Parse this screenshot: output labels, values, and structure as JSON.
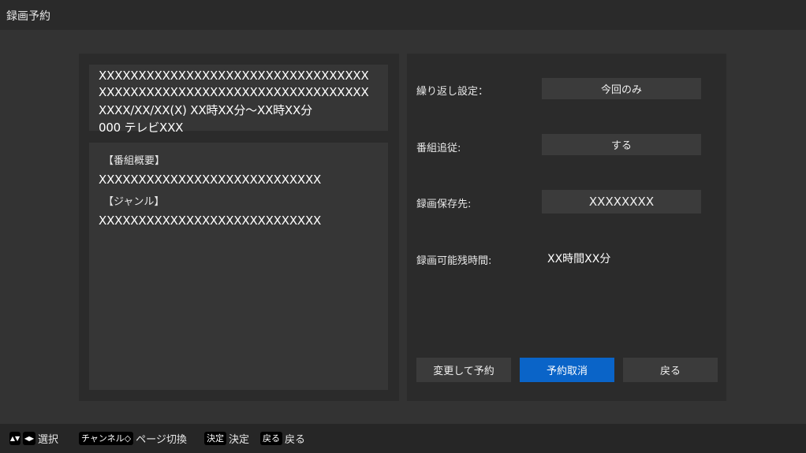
{
  "header": {
    "title": "録画予約"
  },
  "program": {
    "title_line1": "XXXXXXXXXXXXXXXXXXXXXXXXXXXXXXXXXX",
    "title_line2": "XXXXXXXXXXXXXXXXXXXXXXXXXXXXXXXXXX",
    "datetime": "XXXX/XX/XX(X) XX時XX分～XX時XX分",
    "channel": "000 テレビXXX"
  },
  "details": {
    "summary_label": "【番組概要】",
    "summary_value": "XXXXXXXXXXXXXXXXXXXXXXXXXXXX",
    "genre_label": "【ジャンル】",
    "genre_value": "XXXXXXXXXXXXXXXXXXXXXXXXXXXX"
  },
  "settings": {
    "repeat_label": "繰り返し設定：",
    "repeat_value": "今回のみ",
    "follow_label": "番組追従:",
    "follow_value": "する",
    "dest_label": "録画保存先:",
    "dest_value": "XXXXXXXX",
    "remaining_label": "録画可能残時間:",
    "remaining_value": "XX時間XX分"
  },
  "actions": {
    "change": "変更して予約",
    "cancel": "予約取消",
    "back": "戻る"
  },
  "footer": {
    "up_down_key": "▲▼",
    "left_right_key": "◀▶",
    "select_label": "選択",
    "channel_key": "チャンネル◇",
    "page_label": "ページ切換",
    "ok_key": "決定",
    "ok_label": "決定",
    "back_key": "戻る",
    "back_label": "戻る"
  },
  "colors": {
    "background": "#333333",
    "panel": "#2b2b2b",
    "accent": "#0a64c8"
  }
}
